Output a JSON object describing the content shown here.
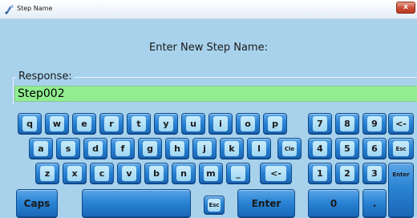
{
  "window": {
    "title": "Step Name",
    "close_label": "x"
  },
  "prompt": "Enter New Step Name:",
  "response": {
    "label": "Response:",
    "value": "Step002"
  },
  "keyboard": {
    "row1": [
      "q",
      "w",
      "e",
      "r",
      "t",
      "y",
      "u",
      "i",
      "o",
      "p"
    ],
    "row2": [
      "a",
      "s",
      "d",
      "f",
      "g",
      "h",
      "j",
      "k",
      "l"
    ],
    "row3": [
      "z",
      "x",
      "c",
      "v",
      "b",
      "n",
      "m",
      "_"
    ],
    "clear_label": "Cle",
    "backspace_label": "<-",
    "caps_label": "Caps",
    "space_label": "",
    "esc_label": "Esc",
    "enter_label": "Enter"
  },
  "numpad": {
    "row1": [
      "7",
      "8",
      "9"
    ],
    "row2": [
      "4",
      "5",
      "6"
    ],
    "row3": [
      "1",
      "2",
      "3"
    ],
    "zero": "0",
    "dot": ".",
    "backspace_label": "<-",
    "esc_label": "Esc",
    "enter_label": "Enter"
  },
  "colors": {
    "background": "#a8d2ec",
    "response_field": "#90ee90",
    "key_blue": "#2a83d4"
  }
}
